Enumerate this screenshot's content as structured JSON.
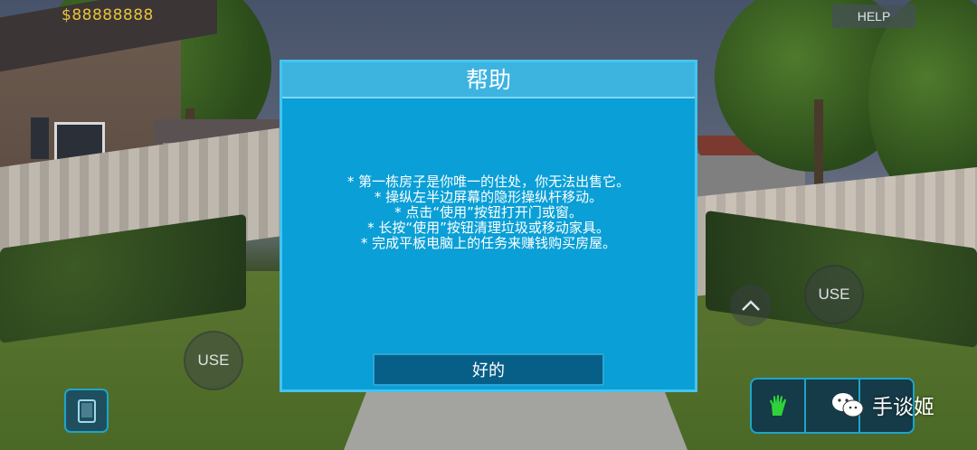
{
  "hud": {
    "money": "$88888888",
    "help_label": "HELP",
    "use_label_left": "USE",
    "use_label_right": "USE"
  },
  "dialog": {
    "title": "帮助",
    "lines": [
      "* 第一栋房子是你唯一的住处，你无法出售它。",
      "* 操纵左半边屏幕的隐形操纵杆移动。",
      "* 点击“使用”按钮打开门或窗。",
      "* 长按“使用”按钮清理垃圾或移动家具。",
      "* 完成平板电脑上的任务来赚钱购买房屋。"
    ],
    "ok_label": "好的"
  },
  "watermark": {
    "text": "手谈姬"
  },
  "icons": {
    "tablet": "tablet-icon",
    "hand": "hand-icon",
    "up": "chevron-up-icon",
    "wechat": "wechat-icon"
  },
  "colors": {
    "dialog_bg": "#0a9fd6",
    "dialog_border": "#45c4ef",
    "title_bar": "#3db3e0",
    "ok_button": "#075f88",
    "money": "#e8c33a",
    "hand_icon": "#2fd23a"
  }
}
